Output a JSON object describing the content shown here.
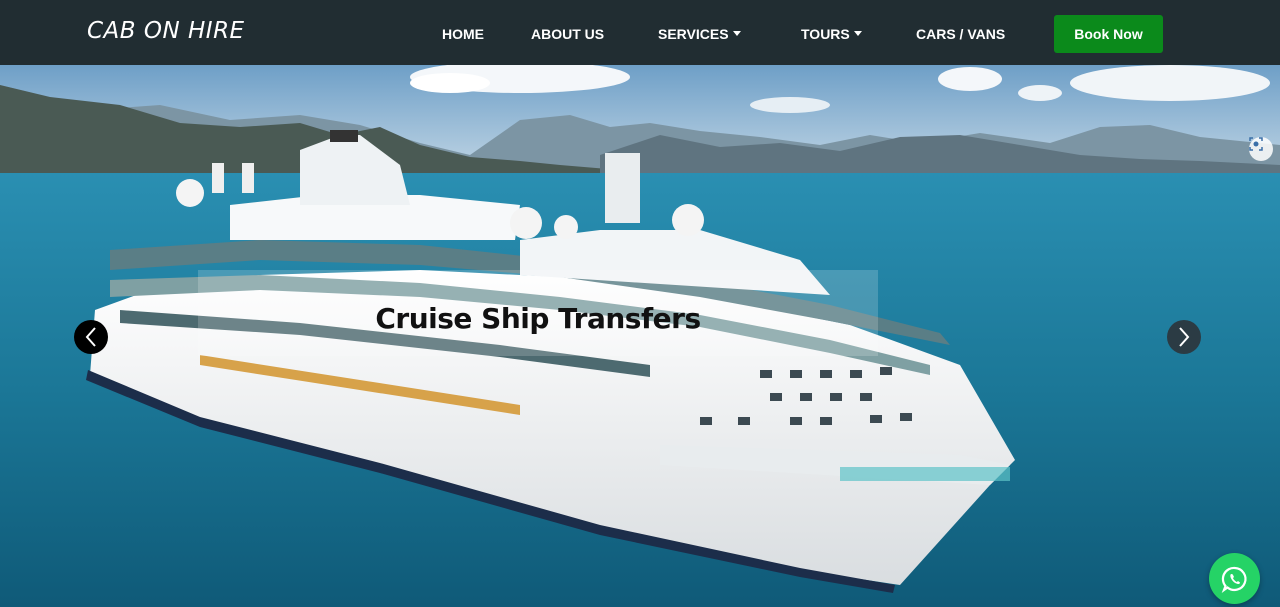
{
  "brand": {
    "name": "CAB ON HIRE"
  },
  "nav": {
    "home": "HOME",
    "about": "ABOUT US",
    "services": "SERVICES",
    "tours": "TOURS",
    "cars": "CARS / VANS",
    "book": "Book Now"
  },
  "hero": {
    "caption": "Cruise Ship Transfers"
  },
  "icons": {
    "prev": "chevron-left-icon",
    "next": "chevron-right-icon",
    "lens": "lens-icon",
    "whatsapp": "whatsapp-icon"
  },
  "colors": {
    "navbar": "#212d32",
    "book_button": "#0b8a1b",
    "whatsapp": "#25d366",
    "sea": "#1d7a9a"
  }
}
